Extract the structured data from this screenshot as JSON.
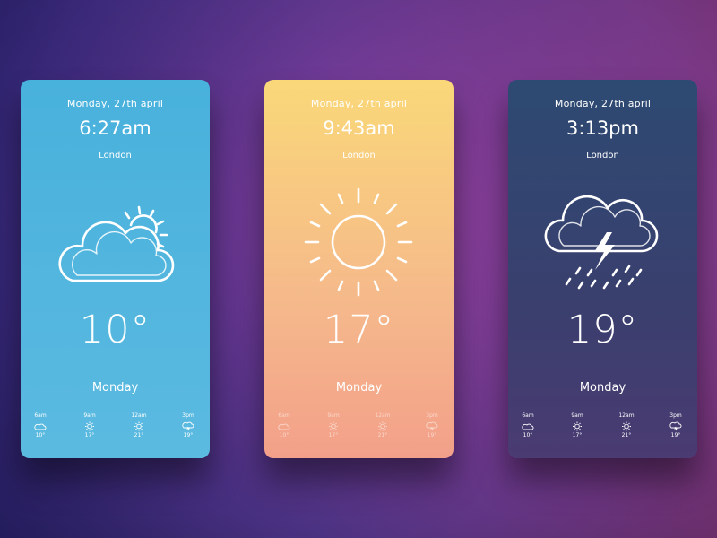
{
  "cards": [
    {
      "date": "Monday, 27th april",
      "time": "6:27am",
      "city": "London",
      "icon": "partly-cloudy-icon",
      "temperature": "10°",
      "day": "Monday",
      "background": [
        "#48b1dc",
        "#5bbae0"
      ],
      "hourly": [
        {
          "time": "6am",
          "icon": "cloud-icon",
          "temp": "10°"
        },
        {
          "time": "9am",
          "icon": "sun-icon",
          "temp": "17°"
        },
        {
          "time": "12am",
          "icon": "sun-icon",
          "temp": "21°"
        },
        {
          "time": "3pm",
          "icon": "storm-icon",
          "temp": "19°"
        }
      ]
    },
    {
      "date": "Monday, 27th april",
      "time": "9:43am",
      "city": "London",
      "icon": "sun-icon",
      "temperature": "17°",
      "day": "Monday",
      "background": [
        "#fad879",
        "#f3a08a"
      ],
      "hourly": [
        {
          "time": "6am",
          "icon": "cloud-icon",
          "temp": "10°"
        },
        {
          "time": "9am",
          "icon": "sun-icon",
          "temp": "17°"
        },
        {
          "time": "12am",
          "icon": "sun-icon",
          "temp": "21°"
        },
        {
          "time": "3pm",
          "icon": "storm-icon",
          "temp": "19°"
        }
      ]
    },
    {
      "date": "Monday, 27th april",
      "time": "3:13pm",
      "city": "London",
      "icon": "thunderstorm-icon",
      "temperature": "19°",
      "day": "Monday",
      "background": [
        "#2d4a72",
        "#4a3b72"
      ],
      "hourly": [
        {
          "time": "6am",
          "icon": "cloud-icon",
          "temp": "10°"
        },
        {
          "time": "9am",
          "icon": "sun-icon",
          "temp": "17°"
        },
        {
          "time": "12am",
          "icon": "sun-icon",
          "temp": "21°"
        },
        {
          "time": "3pm",
          "icon": "storm-icon",
          "temp": "19°"
        }
      ]
    }
  ]
}
